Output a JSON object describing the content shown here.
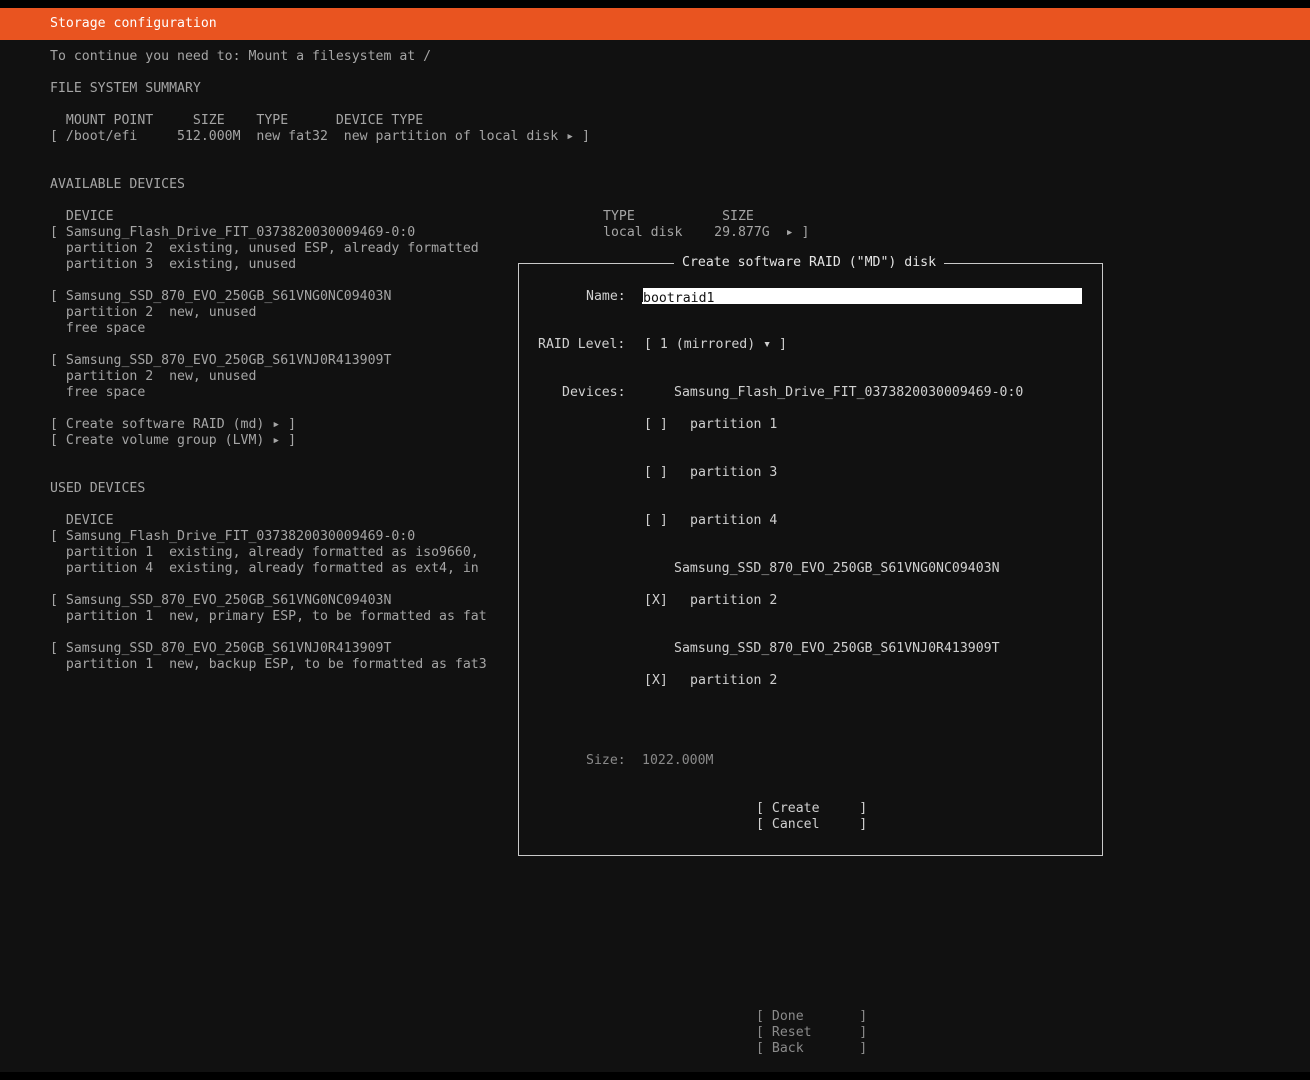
{
  "header": {
    "title": "Storage configuration"
  },
  "notice": "To continue you need to: Mount a filesystem at /",
  "fs_summary": {
    "heading": "FILE SYSTEM SUMMARY",
    "columns": "  MOUNT POINT     SIZE    TYPE      DEVICE TYPE",
    "rows": [
      "[ /boot/efi     512.000M  new fat32  new partition of local disk ▸ ]"
    ]
  },
  "available": {
    "heading": "AVAILABLE DEVICES",
    "col_device": "  DEVICE",
    "col_type_size": "TYPE           SIZE",
    "devices": [
      {
        "name": "[ Samsung_Flash_Drive_FIT_0373820030009469-0:0",
        "type_size": "local disk    29.877G  ▸ ]",
        "parts": [
          "  partition 2  existing, unused ESP, already formatted",
          "  partition 3  existing, unused"
        ]
      },
      {
        "name": "[ Samsung_SSD_870_EVO_250GB_S61VNG0NC09403N",
        "parts": [
          "  partition 2  new, unused",
          "  free space"
        ]
      },
      {
        "name": "[ Samsung_SSD_870_EVO_250GB_S61VNJ0R413909T",
        "parts": [
          "  partition 2  new, unused",
          "  free space"
        ]
      }
    ],
    "actions": [
      "[ Create software RAID (md) ▸ ]",
      "[ Create volume group (LVM) ▸ ]"
    ]
  },
  "used": {
    "heading": "USED DEVICES",
    "col_device": "  DEVICE",
    "devices": [
      {
        "name": "[ Samsung_Flash_Drive_FIT_0373820030009469-0:0",
        "parts": [
          "  partition 1  existing, already formatted as iso9660,",
          "  partition 4  existing, already formatted as ext4, in"
        ]
      },
      {
        "name": "[ Samsung_SSD_870_EVO_250GB_S61VNG0NC09403N",
        "parts": [
          "  partition 1  new, primary ESP, to be formatted as fat"
        ]
      },
      {
        "name": "[ Samsung_SSD_870_EVO_250GB_S61VNJ0R413909T",
        "parts": [
          "  partition 1  new, backup ESP, to be formatted as fat3"
        ]
      }
    ]
  },
  "dialog": {
    "title": "Create software RAID (\"MD\") disk",
    "name_label": "Name:",
    "name_value": "bootraid1",
    "raid_label": "RAID Level:",
    "raid_value": "[ 1 (mirrored) ▾ ]",
    "devices_label": "Devices:",
    "groups": [
      {
        "disk": "Samsung_Flash_Drive_FIT_0373820030009469-0:0",
        "items": [
          {
            "check": "[ ]",
            "label": "partition 1"
          },
          {
            "check": "[ ]",
            "label": "partition 3"
          },
          {
            "check": "[ ]",
            "label": "partition 4"
          }
        ]
      },
      {
        "disk": "Samsung_SSD_870_EVO_250GB_S61VNG0NC09403N",
        "items": [
          {
            "check": "[X]",
            "label": "partition 2"
          }
        ]
      },
      {
        "disk": "Samsung_SSD_870_EVO_250GB_S61VNJ0R413909T",
        "items": [
          {
            "check": "[X]",
            "label": "partition 2"
          }
        ]
      }
    ],
    "size_label": "Size:",
    "size_value": "1022.000M",
    "create": "[ Create     ]",
    "cancel": "[ Cancel     ]"
  },
  "footer": {
    "done": "[ Done       ]",
    "reset": "[ Reset      ]",
    "back": "[ Back       ]"
  },
  "colors": {
    "header_bg": "#e95420",
    "background": "#111111"
  }
}
